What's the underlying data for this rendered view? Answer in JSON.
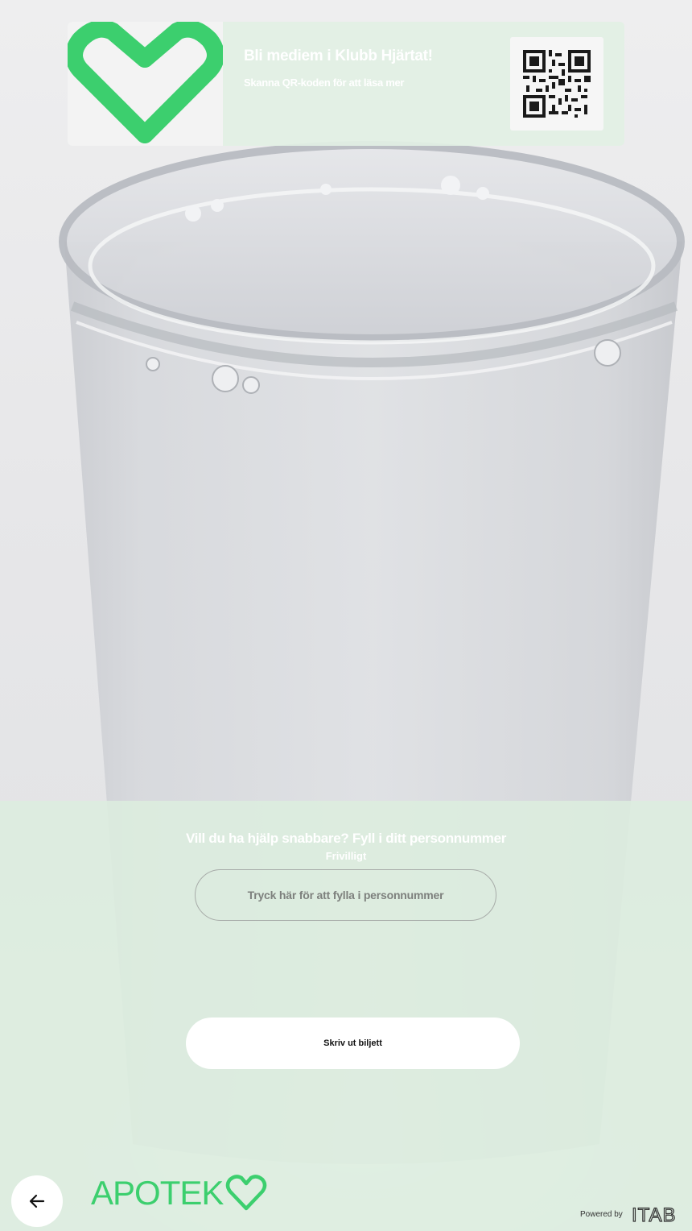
{
  "promo": {
    "title": "Bli mediem i Klubb Hjärtat!",
    "subtitle": "Skanna QR-koden för att läsa mer"
  },
  "form": {
    "prompt": "Vill du ha hjälp snabbare? Fyll i ditt personnummer",
    "optional_label": "Frivilligt",
    "input_placeholder": "Tryck här för att fylla i personnummer"
  },
  "actions": {
    "print_label": "Skriv ut biljett"
  },
  "footer": {
    "powered_by": "Powered by",
    "brand_text": "APOTEK",
    "partner_text": "ITAB"
  },
  "colors": {
    "brand_green": "#3ccf6e",
    "panel_green": "#dceede"
  },
  "icons": {
    "back": "arrow-left-icon",
    "promo_logo": "heart-icon",
    "qr": "qr-code-icon"
  }
}
